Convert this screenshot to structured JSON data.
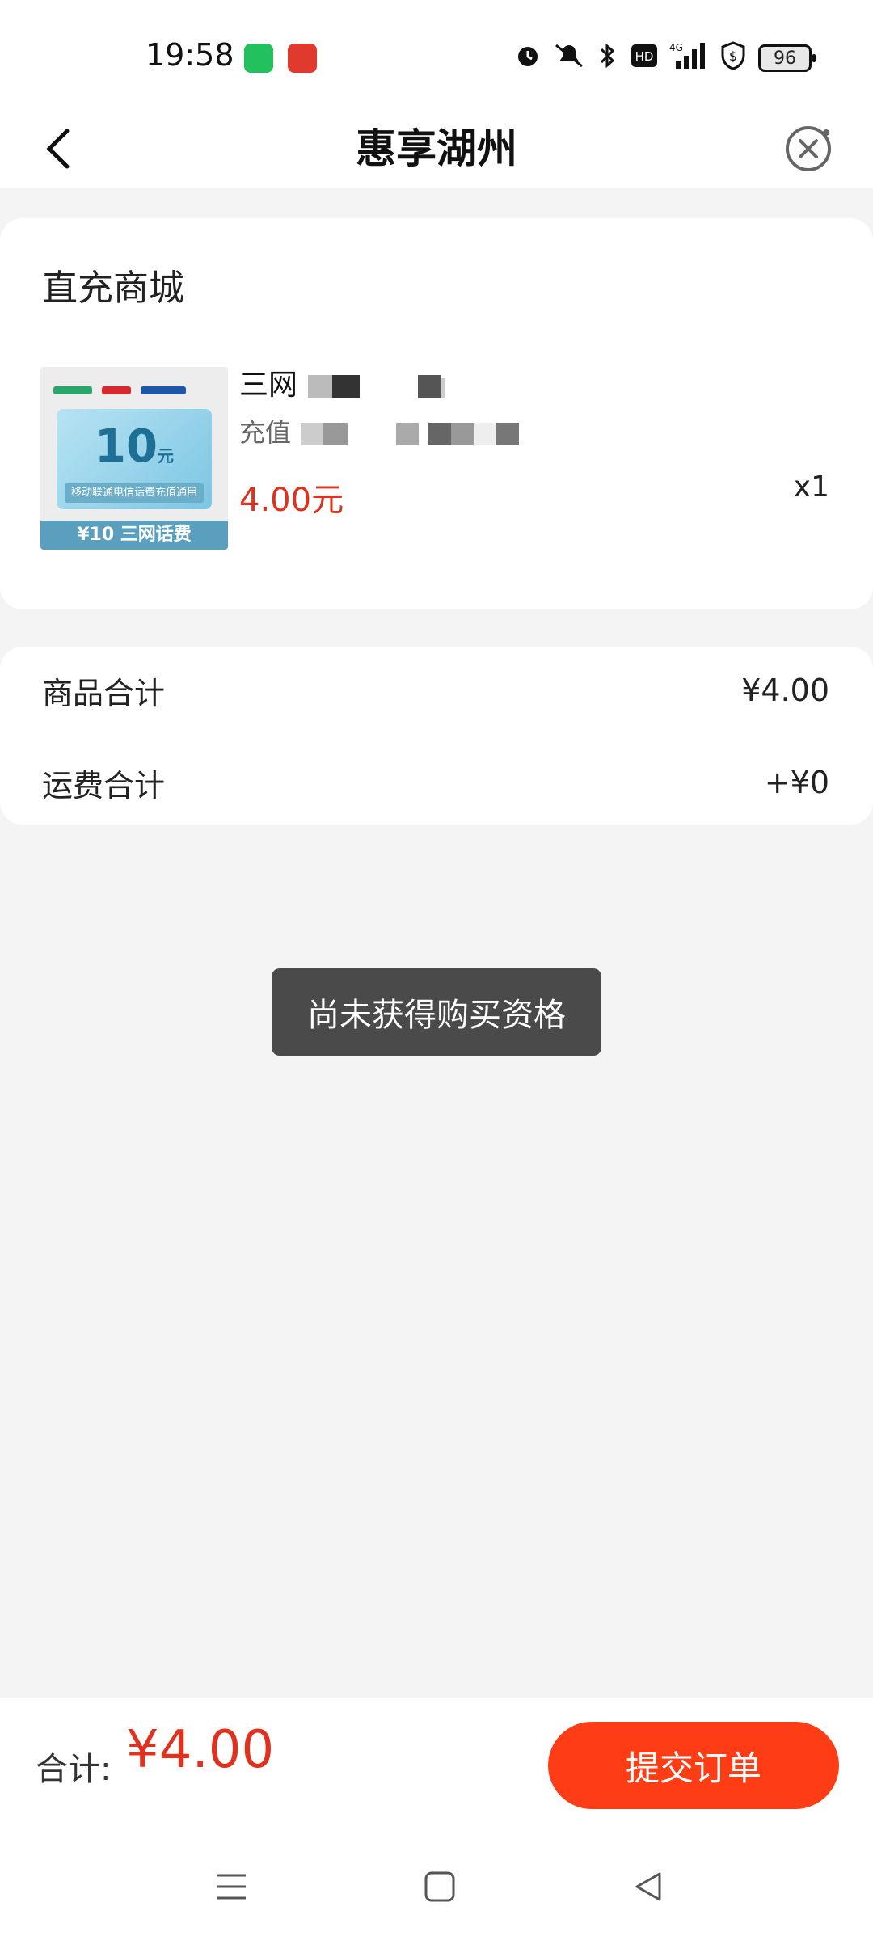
{
  "status_bar": {
    "time": "19:58",
    "network": "4G",
    "battery": "96",
    "hd_label": "HD"
  },
  "nav": {
    "title": "惠享湖州"
  },
  "store": {
    "title": "直充商城",
    "product": {
      "name_visible": "三网",
      "subtitle_visible": "充值",
      "price": "4.00元",
      "quantity": "x1",
      "image": {
        "value": "10",
        "unit": "元",
        "band_text": "移动联通电信话费充值通用",
        "footer_text": "¥10 三网话费"
      }
    }
  },
  "totals": {
    "goods_label": "商品合计",
    "goods_value": "¥4.00",
    "shipping_label": "运费合计",
    "shipping_value": "+¥0"
  },
  "toast": {
    "message": "尚未获得购买资格"
  },
  "bottom_bar": {
    "total_label": "合计:",
    "total_value": "¥4.00",
    "submit_label": "提交订单"
  },
  "colors": {
    "accent": "#fe3d16",
    "price_red": "#e0301e",
    "background": "#f4f4f4",
    "toast_bg": "#4a4a4a"
  }
}
